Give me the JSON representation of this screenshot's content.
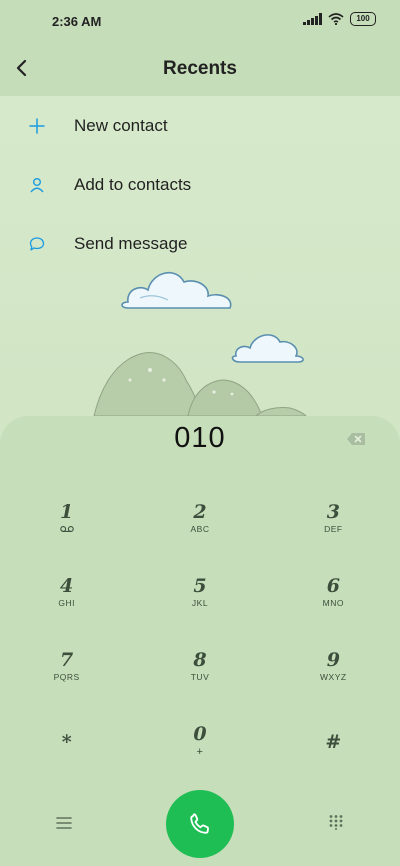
{
  "status_bar": {
    "time": "2:36 AM",
    "battery": "100"
  },
  "header": {
    "title": "Recents"
  },
  "menu": {
    "items": [
      {
        "label": "New contact",
        "icon": "plus-icon"
      },
      {
        "label": "Add to contacts",
        "icon": "person-icon"
      },
      {
        "label": "Send message",
        "icon": "message-bubble-icon"
      }
    ]
  },
  "dialpad": {
    "number": "010",
    "keys": [
      {
        "digit": "1",
        "letters": "voicemail"
      },
      {
        "digit": "2",
        "letters": "ABC"
      },
      {
        "digit": "3",
        "letters": "DEF"
      },
      {
        "digit": "4",
        "letters": "GHI"
      },
      {
        "digit": "5",
        "letters": "JKL"
      },
      {
        "digit": "6",
        "letters": "MNO"
      },
      {
        "digit": "7",
        "letters": "PQRS"
      },
      {
        "digit": "8",
        "letters": "TUV"
      },
      {
        "digit": "9",
        "letters": "WXYZ"
      },
      {
        "digit": "*",
        "letters": ""
      },
      {
        "digit": "0",
        "letters": "+"
      },
      {
        "digit": "#",
        "letters": ""
      }
    ]
  },
  "colors": {
    "accent": "#1a9be0",
    "call_button": "#1fbe55",
    "panel": "#c7deba"
  }
}
